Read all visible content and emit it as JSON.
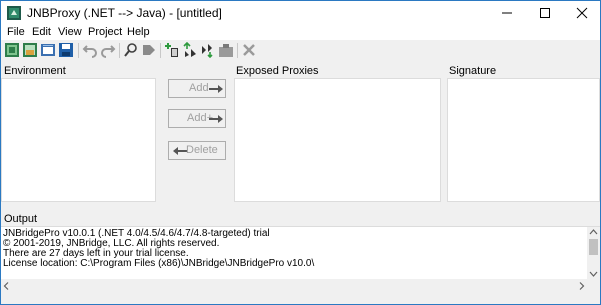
{
  "window": {
    "title": "JNBProxy (.NET --> Java) - [untitled]",
    "accent_color": "#2b79c2"
  },
  "titlebar": {
    "app_icon": "jnbridge-app-icon",
    "minimize_icon": "minimize-icon",
    "maximize_icon": "maximize-icon",
    "close_icon": "close-icon"
  },
  "menu": {
    "items": [
      "File",
      "Edit",
      "View",
      "Project",
      "Help"
    ]
  },
  "toolbar": {
    "buttons": [
      "new-project-icon",
      "open-project-icon",
      "open-recent-icon",
      "save-icon",
      "undo-icon",
      "redo-icon",
      "find-icon",
      "goto-icon",
      "add-classpath-icon",
      "load-classes-icon",
      "generate-proxies-icon",
      "build-icon",
      "delete-icon"
    ]
  },
  "panels": {
    "environment_label": "Environment",
    "exposed_label": "Exposed Proxies",
    "signature_label": "Signature"
  },
  "actions": {
    "add_label": "Add",
    "add_plus_label": "Add+",
    "delete_label": "Delete"
  },
  "output": {
    "label": "Output",
    "lines": [
      "JNBridgePro v10.0.1 (.NET 4.0/4.5/4.6/4.7/4.8-targeted) trial",
      "© 2001-2019, JNBridge, LLC. All rights reserved.",
      "There are 27 days left in your trial license.",
      "License location: C:\\Program Files (x86)\\JNBridge\\JNBridgePro v10.0\\"
    ]
  }
}
